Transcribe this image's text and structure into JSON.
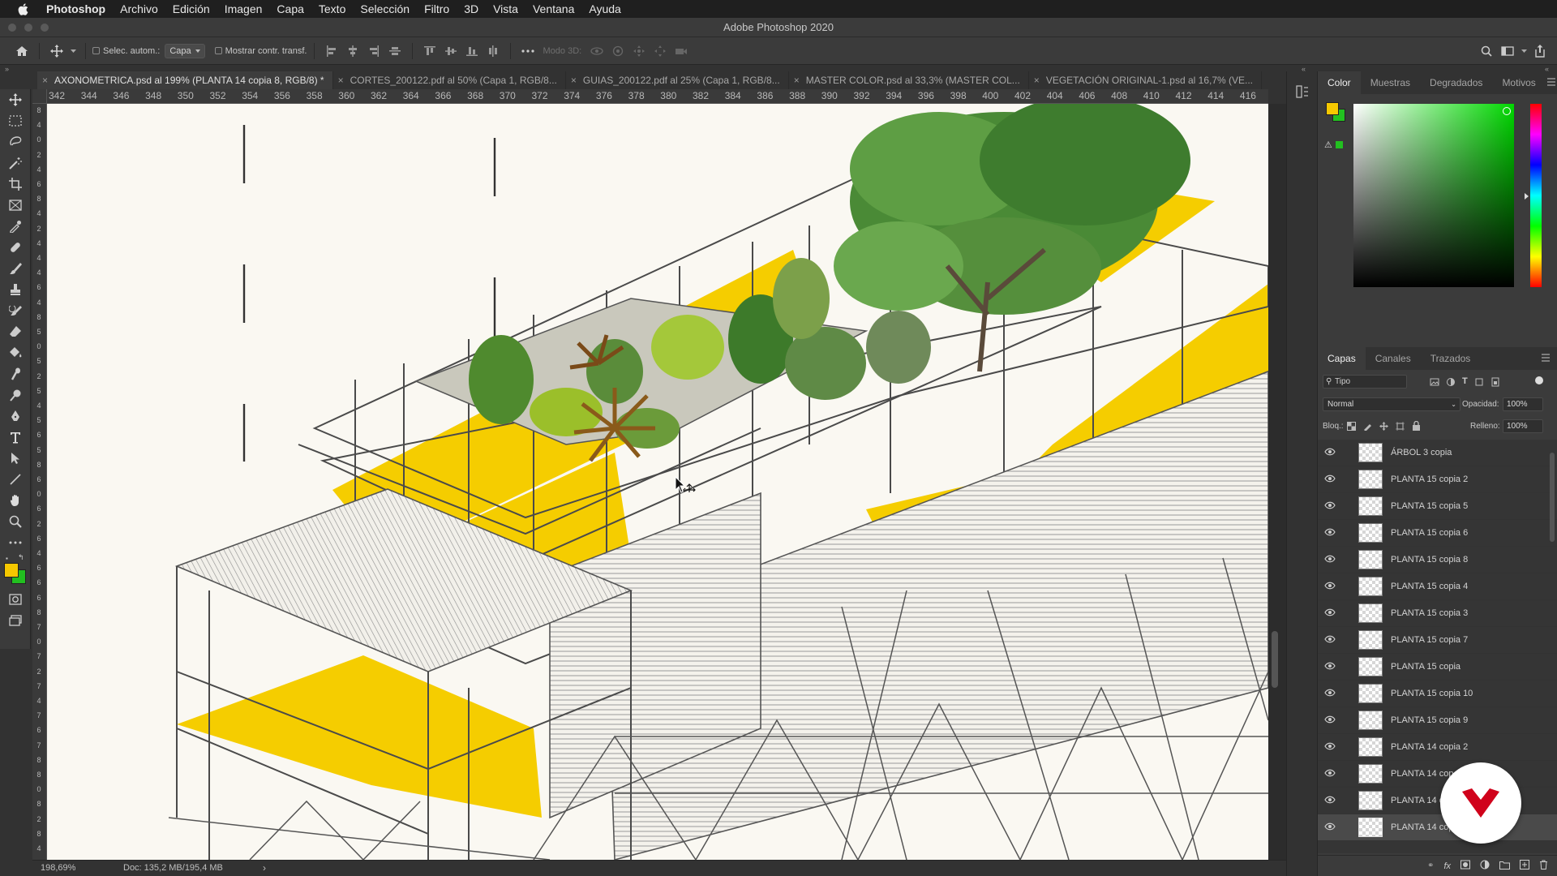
{
  "menubar": {
    "app": "Photoshop",
    "items": [
      "Archivo",
      "Edición",
      "Imagen",
      "Capa",
      "Texto",
      "Selección",
      "Filtro",
      "3D",
      "Vista",
      "Ventana",
      "Ayuda"
    ]
  },
  "window": {
    "title": "Adobe Photoshop 2020"
  },
  "options": {
    "auto_select_label": "Selec. autom.:",
    "auto_select_value": "Capa",
    "show_transform_label": "Mostrar contr. transf.",
    "mode3d_label": "Modo 3D:"
  },
  "tabs": [
    {
      "label": "AXONOMETRICA.psd al 199% (PLANTA 14 copia 8, RGB/8) *",
      "active": true
    },
    {
      "label": "CORTES_200122.pdf al 50% (Capa 1, RGB/8...",
      "active": false
    },
    {
      "label": "GUIAS_200122.pdf al 25% (Capa 1, RGB/8...",
      "active": false
    },
    {
      "label": "MASTER COLOR.psd al 33,3% (MASTER COL...",
      "active": false
    },
    {
      "label": "VEGETACIÓN ORIGINAL-1.psd al 16,7% (VE...",
      "active": false
    }
  ],
  "ruler": {
    "h_ticks": [
      "342",
      "344",
      "346",
      "348",
      "350",
      "352",
      "354",
      "356",
      "358",
      "360",
      "362",
      "364",
      "366",
      "368",
      "370",
      "372",
      "374",
      "376",
      "378",
      "380",
      "382",
      "384",
      "386",
      "388",
      "390",
      "392",
      "394",
      "396",
      "398",
      "400",
      "402",
      "404",
      "406",
      "408",
      "410",
      "412",
      "414",
      "416"
    ],
    "v_ticks": [
      "8",
      "4",
      "0",
      "2",
      "4",
      "6",
      "8",
      "4",
      "2",
      "4",
      "4",
      "4",
      "6",
      "4",
      "8",
      "5",
      "0",
      "5",
      "2",
      "5",
      "4",
      "5",
      "6",
      "5",
      "8",
      "6",
      "0",
      "6",
      "2",
      "6",
      "4",
      "6",
      "6",
      "6",
      "8",
      "7",
      "0",
      "7",
      "2",
      "7",
      "4",
      "7",
      "6",
      "7",
      "8",
      "8",
      "0",
      "8",
      "2",
      "8",
      "4"
    ]
  },
  "color_panel": {
    "tabs": [
      "Color",
      "Muestras",
      "Degradados",
      "Motivos"
    ],
    "foreground": "#f5c800",
    "background": "#22c020",
    "hue_top": "#ff0000"
  },
  "layers_panel": {
    "tabs": [
      "Capas",
      "Canales",
      "Trazados"
    ],
    "filter_label": "Tipo",
    "blend_mode": "Normal",
    "opacity_label": "Opacidad:",
    "opacity_value": "100%",
    "lock_label": "Bloq.:",
    "fill_label": "Relleno:",
    "fill_value": "100%",
    "layers": [
      {
        "name": "ÁRBOL 3 copia"
      },
      {
        "name": "PLANTA 15 copia 2"
      },
      {
        "name": "PLANTA 15 copia 5"
      },
      {
        "name": "PLANTA 15 copia 6"
      },
      {
        "name": "PLANTA 15 copia 8"
      },
      {
        "name": "PLANTA 15 copia 4"
      },
      {
        "name": "PLANTA 15 copia 3"
      },
      {
        "name": "PLANTA 15 copia 7"
      },
      {
        "name": "PLANTA 15 copia"
      },
      {
        "name": "PLANTA 15 copia 10"
      },
      {
        "name": "PLANTA 15 copia 9"
      },
      {
        "name": "PLANTA 14 copia 2"
      },
      {
        "name": "PLANTA 14 cop"
      },
      {
        "name": "PLANTA 14 c"
      },
      {
        "name": "PLANTA 14 cop"
      }
    ]
  },
  "status": {
    "zoom": "198,69%",
    "doc": "Doc: 135,2 MB/195,4 MB"
  },
  "colors": {
    "accent_yellow": "#f5cd00",
    "brand_logo": "#d0021b"
  }
}
